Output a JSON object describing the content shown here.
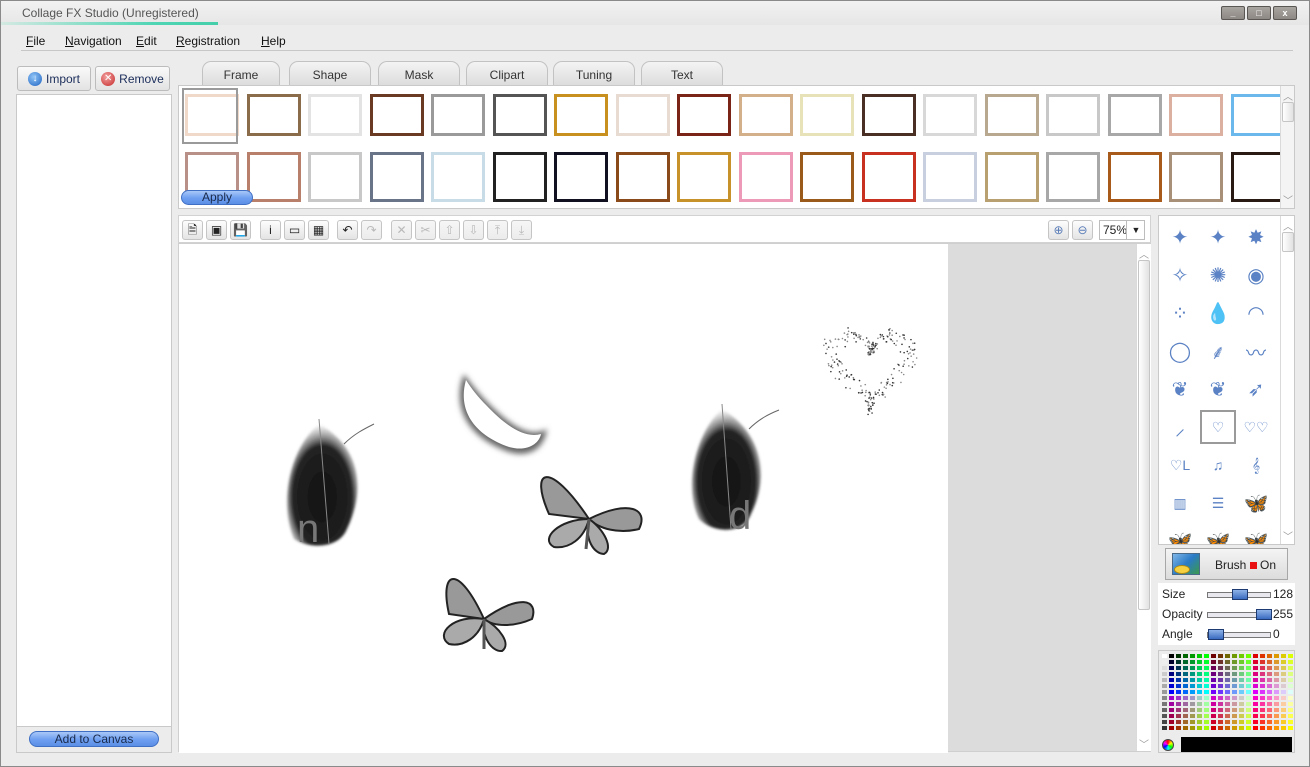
{
  "window": {
    "title": "Collage FX Studio (Unregistered)",
    "minimize": "_",
    "maximize": "□",
    "close": "x"
  },
  "menu": [
    {
      "label": "File",
      "mnemonic": "F",
      "rest": "ile"
    },
    {
      "label": "Navigation",
      "mnemonic": "N",
      "rest": "avigation"
    },
    {
      "label": "Edit",
      "mnemonic": "E",
      "rest": "dit"
    },
    {
      "label": "Registration",
      "mnemonic": "R",
      "rest": "egistration"
    },
    {
      "label": "Help",
      "mnemonic": "H",
      "rest": "elp"
    }
  ],
  "left_panel": {
    "import_label": "Import",
    "remove_label": "Remove",
    "add_to_canvas_label": "Add to Canvas"
  },
  "tabs": [
    {
      "label": "Frame",
      "active": true
    },
    {
      "label": "Shape",
      "active": false
    },
    {
      "label": "Mask",
      "active": false
    },
    {
      "label": "Clipart",
      "active": false
    },
    {
      "label": "Tuning",
      "active": false
    },
    {
      "label": "Text",
      "active": false
    }
  ],
  "frames": {
    "apply_label": "Apply",
    "row1": [
      "#f0d9c8",
      "#8a6b4a",
      "#e3e3e3",
      "#6a3b22",
      "#9a9a9a",
      "#555555",
      "#c8901e",
      "#e8dcd2",
      "#7a2418",
      "#d4b08a",
      "#e8e2b8",
      "#4a3024",
      "#d8d8d8",
      "#b8a890",
      "#c8c8c8",
      "#a8a8a8",
      "#dcb0a0",
      "#6ab8ec"
    ],
    "row2": [
      "#b89088",
      "#b8806a",
      "#c8c8c8",
      "#6a7488",
      "#c8dce8",
      "#222222",
      "#111122",
      "#8a4a1a",
      "#c8922a",
      "#ec9ab8",
      "#9a5a1a",
      "#c83020",
      "#c8d0e0",
      "#b8a070",
      "#a8a8a8",
      "#a85a1a",
      "#a89078",
      "#2a1a14"
    ]
  },
  "toolbar": {
    "buttons": [
      {
        "name": "new-document-icon",
        "glyph": "🗎",
        "enabled": true
      },
      {
        "name": "open-folder-icon",
        "glyph": "▣",
        "enabled": true
      },
      {
        "name": "save-icon",
        "glyph": "💾",
        "enabled": true
      },
      {
        "name": "info-icon",
        "glyph": "i",
        "enabled": true
      },
      {
        "name": "background-icon",
        "glyph": "▭",
        "enabled": true
      },
      {
        "name": "export-image-icon",
        "glyph": "▦",
        "enabled": true
      },
      {
        "name": "undo-icon",
        "glyph": "↶",
        "enabled": true
      },
      {
        "name": "redo-icon",
        "glyph": "↷",
        "enabled": false
      },
      {
        "name": "delete-icon",
        "glyph": "✕",
        "enabled": false
      },
      {
        "name": "cut-icon",
        "glyph": "✂",
        "enabled": false
      },
      {
        "name": "bring-forward-icon",
        "glyph": "⇧",
        "enabled": false
      },
      {
        "name": "send-backward-icon",
        "glyph": "⇩",
        "enabled": false
      },
      {
        "name": "bring-to-front-icon",
        "glyph": "⤒",
        "enabled": false
      },
      {
        "name": "send-to-back-icon",
        "glyph": "⤓",
        "enabled": false
      }
    ],
    "zoom_in": "⊕",
    "zoom_out": "⊖",
    "zoom_value": "75%"
  },
  "brushes": {
    "items": [
      "square-sparkle",
      "four-point-star",
      "eight-point-star",
      "small-sparkle",
      "glow-dot",
      "water-bubble",
      "scatter-dots",
      "water-drop",
      "feather-swoosh",
      "oval-ring",
      "feather-thin",
      "feather-curve",
      "feather-dense",
      "feather-light",
      "quill",
      "quill-small",
      "dotted-heart",
      "double-heart",
      "love-script",
      "music-notes",
      "treble-clef",
      "piano-keys",
      "text-lines",
      "butterfly",
      "butterfly-2",
      "butterfly-3",
      "butterfly-4"
    ],
    "selected_index": 16,
    "toggle_label": "Brush",
    "toggle_state": "On",
    "toggle_state_color": "#e81010"
  },
  "sliders": [
    {
      "label": "Size",
      "value": 128,
      "max": 255
    },
    {
      "label": "Opacity",
      "value": 255,
      "max": 255
    },
    {
      "label": "Angle",
      "value": 0,
      "max": 360
    }
  ],
  "palette": {
    "current_color": "#000000"
  }
}
